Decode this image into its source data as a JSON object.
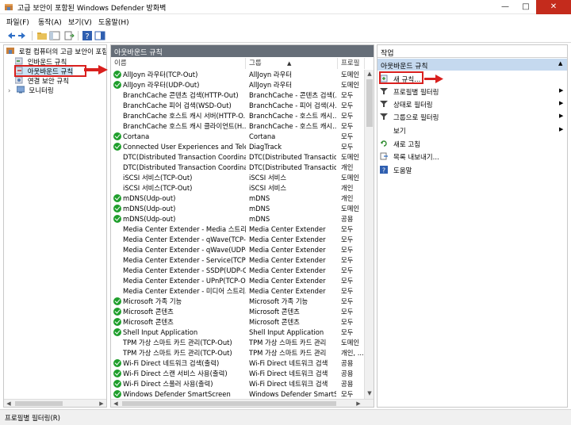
{
  "window": {
    "title": "고급 보안이 포함된 Windows Defender 방화벽"
  },
  "menu": [
    {
      "label": "파일(F)"
    },
    {
      "label": "동작(A)"
    },
    {
      "label": "보기(V)"
    },
    {
      "label": "도움말(H)"
    }
  ],
  "tree": {
    "root": "로컬 컴퓨터의 고급 보안이 포함",
    "items": [
      "인바운드 규칙",
      "아웃바운드 규칙",
      "연결 보안 규칙",
      "모니터링"
    ]
  },
  "middle": {
    "title": "아웃바운드 규칙",
    "columns": [
      "이름",
      "그룹",
      "프로필"
    ],
    "rows": [
      {
        "enabled": true,
        "name": "AllJoyn 라우터(TCP-Out)",
        "group": "AllJoyn 라우터",
        "profile": "도메인"
      },
      {
        "enabled": true,
        "name": "AllJoyn 라우터(UDP-Out)",
        "group": "AllJoyn 라우터",
        "profile": "도메인"
      },
      {
        "enabled": false,
        "name": "BranchCache 콘텐츠 검색(HTTP-Out)",
        "group": "BranchCache - 콘텐츠 검색(...",
        "profile": "모두"
      },
      {
        "enabled": false,
        "name": "BranchCache 피어 검색(WSD-Out)",
        "group": "BranchCache - 피어 검색(사...",
        "profile": "모두"
      },
      {
        "enabled": false,
        "name": "BranchCache 호스트 캐시 서버(HTTP-O...",
        "group": "BranchCache - 호스트 캐시...",
        "profile": "모두"
      },
      {
        "enabled": false,
        "name": "BranchCache 호스트 캐시 클라이언트(H...",
        "group": "BranchCache - 호스트 캐시...",
        "profile": "모두"
      },
      {
        "enabled": true,
        "name": "Cortana",
        "group": "Cortana",
        "profile": "모두"
      },
      {
        "enabled": true,
        "name": "Connected User Experiences and Teleme...",
        "group": "DiagTrack",
        "profile": "모두"
      },
      {
        "enabled": false,
        "name": "DTC(Distributed Transaction Coordinato...",
        "group": "DTC(Distributed Transactio...",
        "profile": "도메인"
      },
      {
        "enabled": false,
        "name": "DTC(Distributed Transaction Coordinato...",
        "group": "DTC(Distributed Transactio...",
        "profile": "개인"
      },
      {
        "enabled": false,
        "name": "iSCSI 서비스(TCP-Out)",
        "group": "iSCSI 서비스",
        "profile": "도메인"
      },
      {
        "enabled": false,
        "name": "iSCSI 서비스(TCP-Out)",
        "group": "iSCSI 서비스",
        "profile": "개인"
      },
      {
        "enabled": true,
        "name": "mDNS(Udp-out)",
        "group": "mDNS",
        "profile": "개인"
      },
      {
        "enabled": true,
        "name": "mDNS(Udp-out)",
        "group": "mDNS",
        "profile": "도메인"
      },
      {
        "enabled": true,
        "name": "mDNS(Udp-out)",
        "group": "mDNS",
        "profile": "공용"
      },
      {
        "enabled": false,
        "name": "Media Center Extender - Media 스트리...",
        "group": "Media Center Extender",
        "profile": "모두"
      },
      {
        "enabled": false,
        "name": "Media Center Extender - qWave(TCP-Out)",
        "group": "Media Center Extender",
        "profile": "모두"
      },
      {
        "enabled": false,
        "name": "Media Center Extender - qWave(UDP-O...",
        "group": "Media Center Extender",
        "profile": "모두"
      },
      {
        "enabled": false,
        "name": "Media Center Extender - Service(TCP-O...",
        "group": "Media Center Extender",
        "profile": "모두"
      },
      {
        "enabled": false,
        "name": "Media Center Extender - SSDP(UDP-Out)",
        "group": "Media Center Extender",
        "profile": "모두"
      },
      {
        "enabled": false,
        "name": "Media Center Extender - UPnP(TCP-Out)",
        "group": "Media Center Extender",
        "profile": "모두"
      },
      {
        "enabled": false,
        "name": "Media Center Extender - 미디어 스트리...",
        "group": "Media Center Extender",
        "profile": "모두"
      },
      {
        "enabled": true,
        "name": "Microsoft 가족 기능",
        "group": "Microsoft 가족 기능",
        "profile": "모두"
      },
      {
        "enabled": true,
        "name": "Microsoft 콘텐츠",
        "group": "Microsoft 콘텐츠",
        "profile": "모두"
      },
      {
        "enabled": true,
        "name": "Microsoft 콘텐츠",
        "group": "Microsoft 콘텐츠",
        "profile": "모두"
      },
      {
        "enabled": true,
        "name": "Shell Input Application",
        "group": "Shell Input Application",
        "profile": "모두"
      },
      {
        "enabled": false,
        "name": "TPM 가상 스마트 카드 관리(TCP-Out)",
        "group": "TPM 가상 스마트 카드 관리",
        "profile": "도메인"
      },
      {
        "enabled": false,
        "name": "TPM 가상 스마트 카드 관리(TCP-Out)",
        "group": "TPM 가상 스마트 카드 관리",
        "profile": "개인, ..."
      },
      {
        "enabled": true,
        "name": "Wi-Fi Direct 네트워크 검색(출력)",
        "group": "Wi-Fi Direct 네트워크 검색",
        "profile": "공용"
      },
      {
        "enabled": true,
        "name": "Wi-Fi Direct 스캔 서비스 사용(출력)",
        "group": "Wi-Fi Direct 네트워크 검색",
        "profile": "공용"
      },
      {
        "enabled": true,
        "name": "Wi-Fi Direct 스풀러 사용(출력)",
        "group": "Wi-Fi Direct 네트워크 검색",
        "profile": "공용"
      },
      {
        "enabled": true,
        "name": "Windows Defender SmartScreen",
        "group": "Windows Defender SmartS...",
        "profile": "모두"
      }
    ]
  },
  "actions": {
    "title": "작업",
    "section": "아웃바운드 규칙",
    "items": [
      {
        "label": "새 규칙...",
        "icon": "new-rule-icon",
        "submenu": false
      },
      {
        "label": "프로필별 필터링",
        "icon": "filter-icon",
        "submenu": true
      },
      {
        "label": "상태로 필터링",
        "icon": "filter-icon",
        "submenu": true
      },
      {
        "label": "그룹으로 필터링",
        "icon": "filter-icon",
        "submenu": true
      },
      {
        "label": "보기",
        "icon": "none",
        "submenu": true
      },
      {
        "label": "새로 고침",
        "icon": "refresh-icon",
        "submenu": false
      },
      {
        "label": "목록 내보내기...",
        "icon": "export-icon",
        "submenu": false
      },
      {
        "label": "도움말",
        "icon": "help-icon",
        "submenu": false
      }
    ]
  },
  "status": {
    "text": "프로필별 필터링(R)"
  },
  "colors": {
    "highlight": "#d9201e",
    "enabled_check": "#1f9f2c",
    "section_bg": "#c5d9ef",
    "header_bg": "#666e78"
  }
}
